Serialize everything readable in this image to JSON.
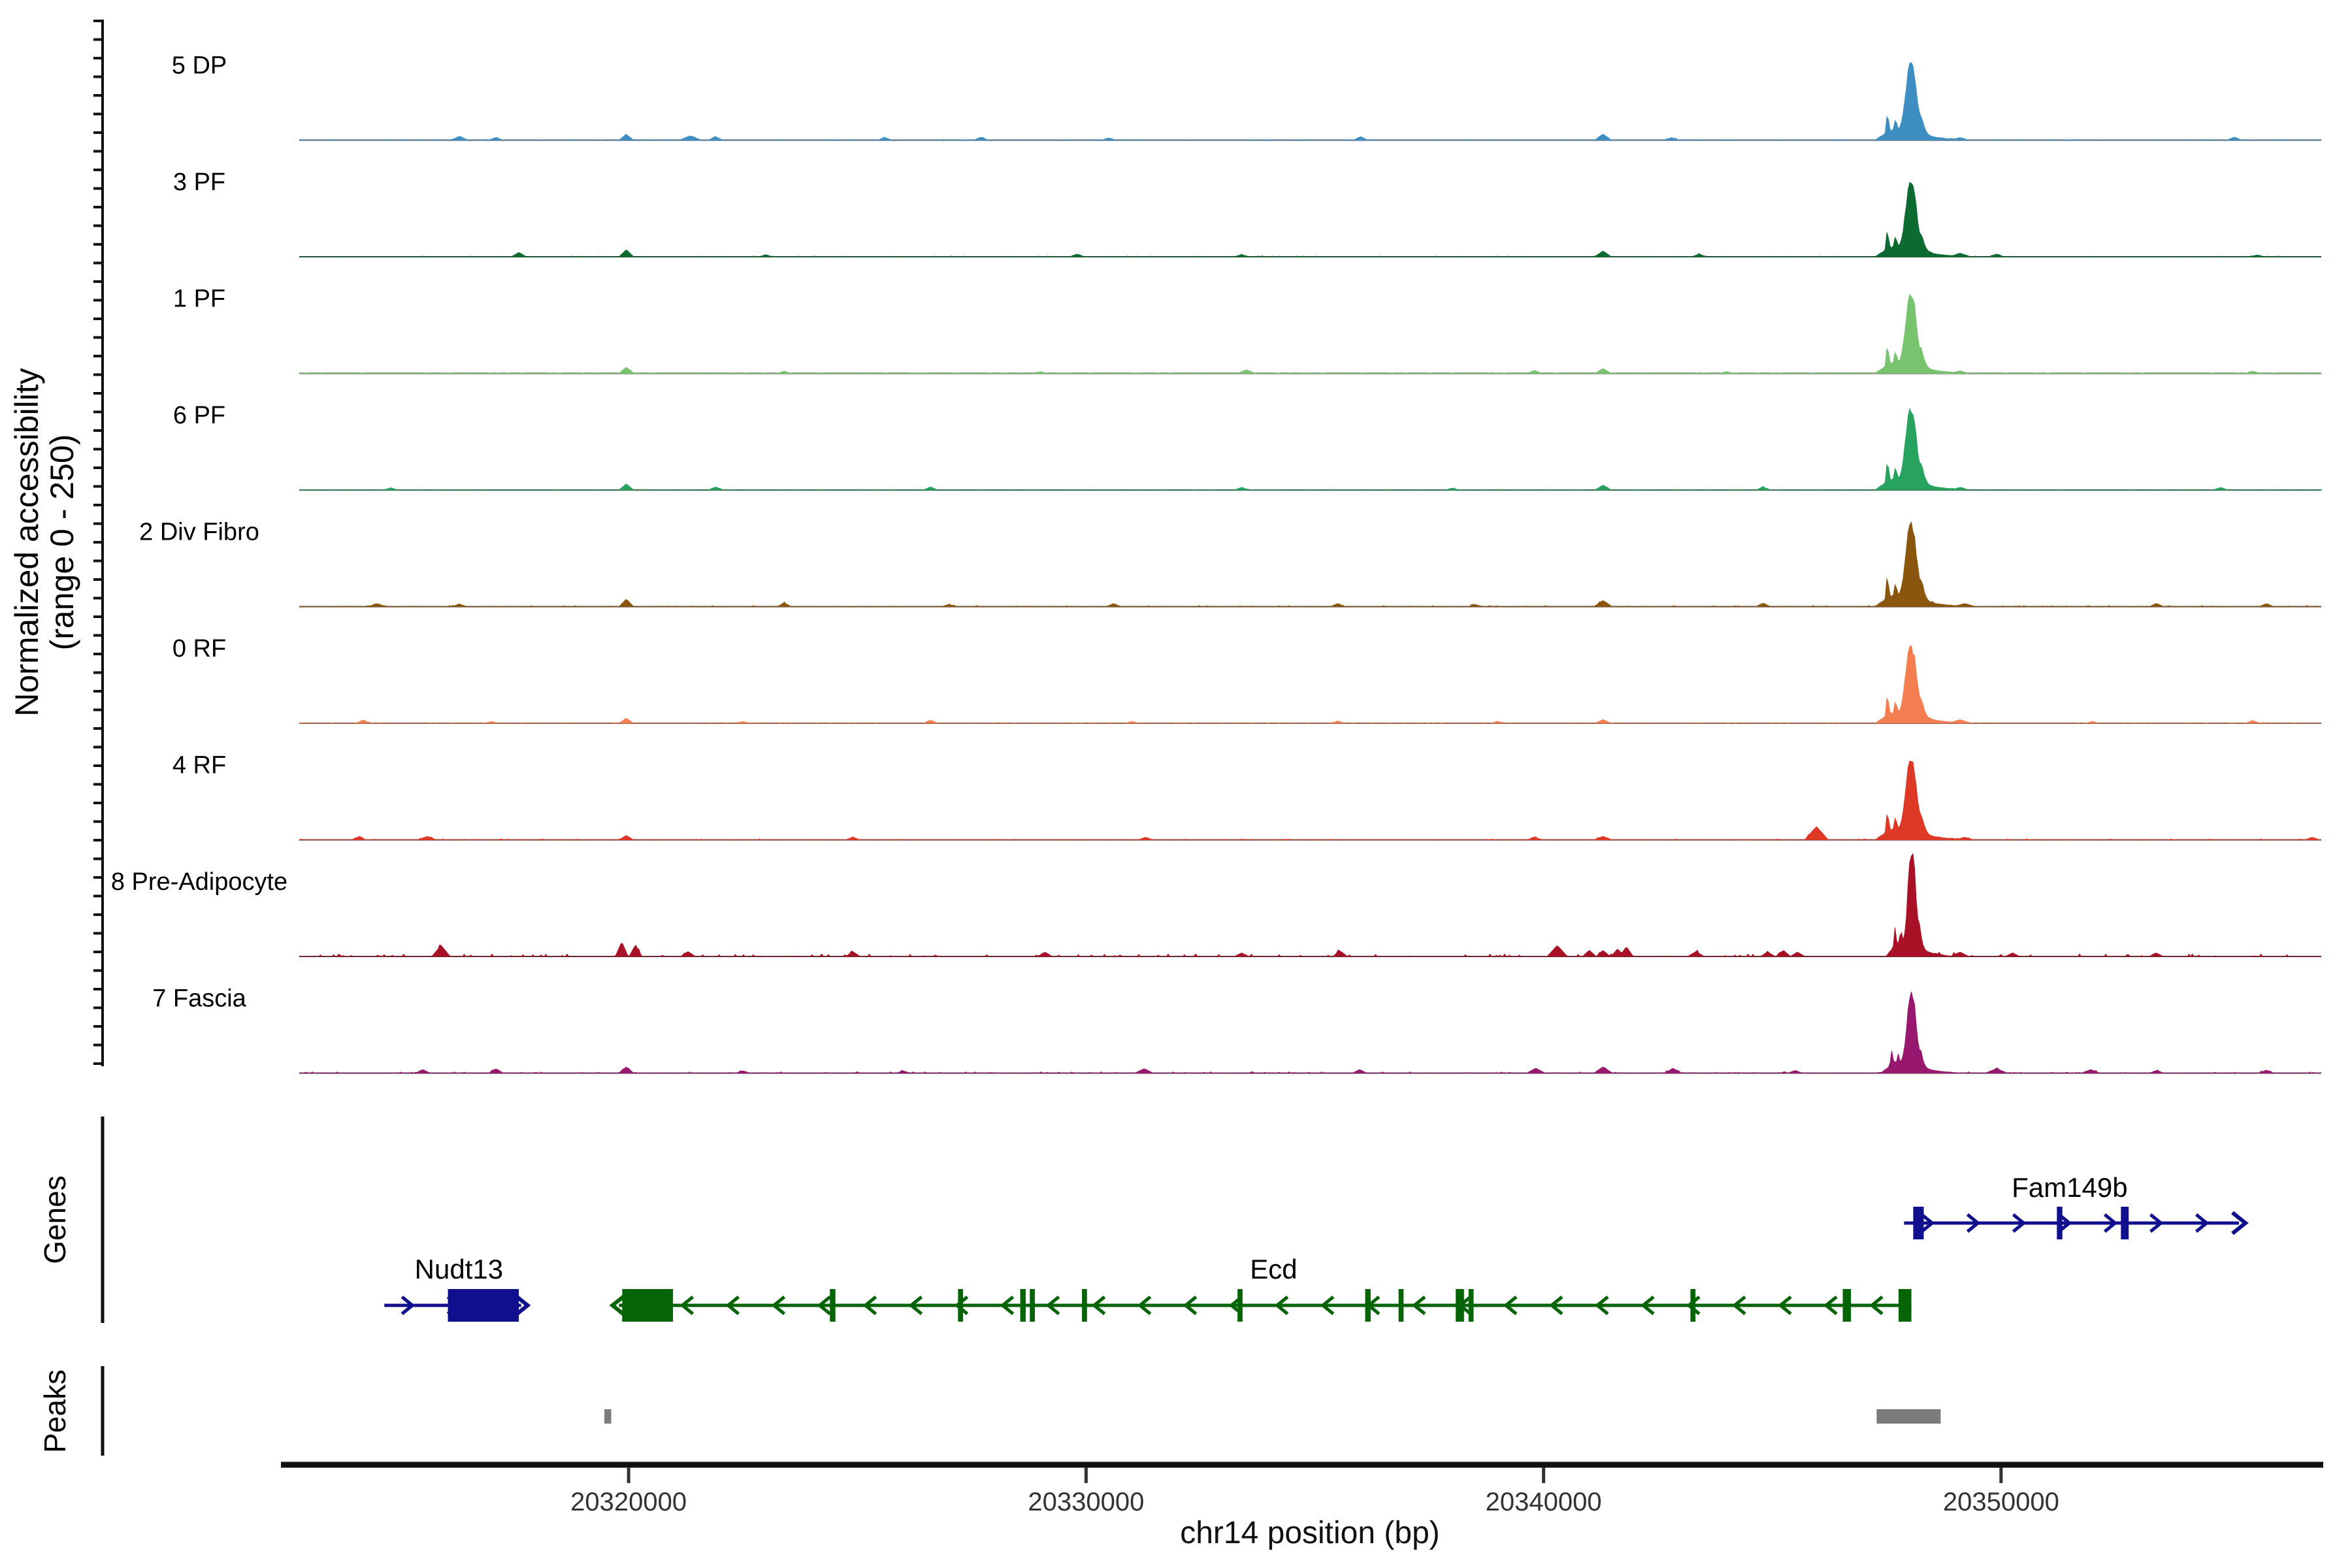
{
  "sections": {
    "genes": "Genes",
    "peaks": "Peaks"
  },
  "chart_data": {
    "type": "area",
    "title": "",
    "x_axis": {
      "label": "chr14 position (bp)",
      "ticks": [
        20320000,
        20330000,
        20340000,
        20350000
      ],
      "range": [
        20312800,
        20357000
      ]
    },
    "y_axis": {
      "title_line1": "Normalized accessibility",
      "title_line2": "(range 0 - 250)",
      "range": [
        0,
        250
      ]
    },
    "peak_profile": [
      [
        -850,
        0
      ],
      [
        -760,
        0.04
      ],
      [
        -640,
        0.08
      ],
      [
        -610,
        0.15
      ],
      [
        -595,
        0.34
      ],
      [
        -580,
        0.26
      ],
      [
        -565,
        0.3
      ],
      [
        -550,
        0.18
      ],
      [
        -520,
        0.13
      ],
      [
        -480,
        0.12
      ],
      [
        -440,
        0.16
      ],
      [
        -415,
        0.28
      ],
      [
        -400,
        0.22
      ],
      [
        -390,
        0.26
      ],
      [
        -370,
        0.16
      ],
      [
        -340,
        0.15
      ],
      [
        -300,
        0.18
      ],
      [
        -260,
        0.28
      ],
      [
        -230,
        0.4
      ],
      [
        -200,
        0.55
      ],
      [
        -170,
        0.72
      ],
      [
        -140,
        0.85
      ],
      [
        -115,
        0.93
      ],
      [
        -90,
        0.98
      ],
      [
        -65,
        1.0
      ],
      [
        -40,
        0.96
      ],
      [
        -15,
        0.92
      ],
      [
        10,
        0.84
      ],
      [
        35,
        0.72
      ],
      [
        60,
        0.58
      ],
      [
        85,
        0.45
      ],
      [
        110,
        0.36
      ],
      [
        135,
        0.3
      ],
      [
        160,
        0.32
      ],
      [
        185,
        0.26
      ],
      [
        215,
        0.19
      ],
      [
        250,
        0.13
      ],
      [
        290,
        0.09
      ],
      [
        340,
        0.06
      ],
      [
        420,
        0.045
      ],
      [
        500,
        0.035
      ],
      [
        600,
        0.028
      ],
      [
        720,
        0.02
      ],
      [
        850,
        0.014
      ],
      [
        1000,
        0.008
      ],
      [
        1200,
        0
      ]
    ],
    "tracks": [
      {
        "label": "5 DP",
        "color": "#3E8EC4",
        "peak_height": 171,
        "peak_center_bp": 20348100,
        "peak_width_scale": 1,
        "noise_level": 0.5,
        "bumps": [
          [
            20316300,
            8,
            200
          ],
          [
            20317100,
            6,
            160
          ],
          [
            20319950,
            13,
            160
          ],
          [
            20321350,
            10,
            240
          ],
          [
            20321900,
            8,
            160
          ],
          [
            20325600,
            6,
            160
          ],
          [
            20327700,
            7,
            160
          ],
          [
            20330500,
            5,
            160
          ],
          [
            20336000,
            8,
            160
          ],
          [
            20341300,
            14,
            180
          ],
          [
            20342800,
            6,
            160
          ],
          [
            20349100,
            6,
            200
          ],
          [
            20355100,
            7,
            160
          ]
        ]
      },
      {
        "label": "3 PF",
        "color": "#0B6B31",
        "peak_height": 166,
        "peak_center_bp": 20348100,
        "peak_width_scale": 1,
        "noise_level": 0.5,
        "bumps": [
          [
            20317600,
            10,
            160
          ],
          [
            20319950,
            16,
            160
          ],
          [
            20323000,
            4,
            160
          ],
          [
            20329800,
            6,
            160
          ],
          [
            20333400,
            5,
            160
          ],
          [
            20341300,
            13,
            180
          ],
          [
            20343400,
            6,
            160
          ],
          [
            20349100,
            8,
            240
          ],
          [
            20349900,
            6,
            160
          ],
          [
            20355600,
            4,
            160
          ]
        ]
      },
      {
        "label": "1 PF",
        "color": "#77C36E",
        "peak_height": 177,
        "peak_center_bp": 20348100,
        "peak_width_scale": 1,
        "noise_level": 0.4,
        "bumps": [
          [
            20319950,
            14,
            160
          ],
          [
            20323400,
            5,
            160
          ],
          [
            20329000,
            4,
            160
          ],
          [
            20333500,
            8,
            200
          ],
          [
            20339800,
            7,
            160
          ],
          [
            20341300,
            11,
            180
          ],
          [
            20344000,
            4,
            160
          ],
          [
            20349100,
            6,
            200
          ],
          [
            20355500,
            5,
            160
          ]
        ]
      },
      {
        "label": "6 PF",
        "color": "#27A35F",
        "peak_height": 183,
        "peak_center_bp": 20348100,
        "peak_width_scale": 1,
        "noise_level": 0.5,
        "bumps": [
          [
            20314800,
            5,
            160
          ],
          [
            20319950,
            14,
            160
          ],
          [
            20321900,
            7,
            160
          ],
          [
            20326600,
            7,
            160
          ],
          [
            20333400,
            6,
            160
          ],
          [
            20338000,
            4,
            160
          ],
          [
            20341300,
            11,
            180
          ],
          [
            20344800,
            7,
            160
          ],
          [
            20349100,
            6,
            200
          ],
          [
            20354800,
            6,
            160
          ]
        ]
      },
      {
        "label": "2 Div Fibro",
        "color": "#8A560E",
        "peak_height": 185,
        "peak_center_bp": 20348100,
        "peak_width_scale": 1,
        "noise_level": 0.8,
        "bumps": [
          [
            20314500,
            7,
            200
          ],
          [
            20316300,
            6,
            160
          ],
          [
            20319950,
            17,
            160
          ],
          [
            20323400,
            8,
            160
          ],
          [
            20327000,
            5,
            160
          ],
          [
            20330600,
            7,
            160
          ],
          [
            20335500,
            7,
            160
          ],
          [
            20338500,
            5,
            160
          ],
          [
            20341300,
            14,
            200
          ],
          [
            20344800,
            8,
            160
          ],
          [
            20349200,
            7,
            240
          ],
          [
            20353400,
            7,
            160
          ],
          [
            20355800,
            7,
            160
          ]
        ]
      },
      {
        "label": "0 RF",
        "color": "#F57E51",
        "peak_height": 174,
        "peak_center_bp": 20348100,
        "peak_width_scale": 1,
        "noise_level": 0.5,
        "bumps": [
          [
            20314200,
            7,
            160
          ],
          [
            20317000,
            4,
            160
          ],
          [
            20319950,
            11,
            160
          ],
          [
            20322500,
            4,
            160
          ],
          [
            20326600,
            7,
            160
          ],
          [
            20331000,
            4,
            160
          ],
          [
            20335500,
            5,
            160
          ],
          [
            20339000,
            4,
            160
          ],
          [
            20341300,
            8,
            180
          ],
          [
            20349100,
            8,
            260
          ],
          [
            20352000,
            4,
            160
          ],
          [
            20355500,
            6,
            160
          ]
        ]
      },
      {
        "label": "4 RF",
        "color": "#DE3926",
        "peak_height": 180,
        "peak_center_bp": 20348100,
        "peak_width_scale": 1,
        "noise_level": 0.6,
        "bumps": [
          [
            20314100,
            7,
            160
          ],
          [
            20315600,
            8,
            200
          ],
          [
            20319950,
            10,
            160
          ],
          [
            20324900,
            6,
            160
          ],
          [
            20331300,
            6,
            160
          ],
          [
            20339800,
            6,
            160
          ],
          [
            20341300,
            8,
            200
          ],
          [
            20345965,
            30,
            260
          ],
          [
            20349200,
            6,
            200
          ],
          [
            20356800,
            6,
            160
          ]
        ]
      },
      {
        "label": "8 Pre-Adipocyte",
        "color": "#A81126",
        "peak_height": 238,
        "peak_center_bp": 20348100,
        "peak_width_scale": 0.72,
        "noise_level": 1.7,
        "bumps": [
          [
            20315900,
            25,
            200
          ],
          [
            20319850,
            33,
            140
          ],
          [
            20320150,
            26,
            140
          ],
          [
            20321300,
            11,
            160
          ],
          [
            20324900,
            11,
            160
          ],
          [
            20329100,
            10,
            160
          ],
          [
            20333400,
            8,
            160
          ],
          [
            20335550,
            13,
            160
          ],
          [
            20340300,
            25,
            220
          ],
          [
            20341000,
            14,
            150
          ],
          [
            20341300,
            14,
            150
          ],
          [
            20341620,
            17,
            150
          ],
          [
            20341810,
            22,
            150
          ],
          [
            20343330,
            11,
            180
          ],
          [
            20344900,
            10,
            160
          ],
          [
            20345240,
            14,
            160
          ],
          [
            20345550,
            10,
            160
          ],
          [
            20349100,
            10,
            200
          ],
          [
            20350250,
            8,
            160
          ],
          [
            20353390,
            8,
            160
          ]
        ]
      },
      {
        "label": "7 Fascia",
        "color": "#97186E",
        "peak_height": 177,
        "peak_center_bp": 20348100,
        "peak_width_scale": 0.85,
        "noise_level": 0.9,
        "bumps": [
          [
            20315500,
            8,
            160
          ],
          [
            20317100,
            10,
            160
          ],
          [
            20319950,
            14,
            160
          ],
          [
            20322500,
            5,
            160
          ],
          [
            20326000,
            5,
            160
          ],
          [
            20331270,
            10,
            200
          ],
          [
            20335980,
            8,
            160
          ],
          [
            20339830,
            11,
            200
          ],
          [
            20341300,
            14,
            200
          ],
          [
            20342830,
            11,
            180
          ],
          [
            20345500,
            6,
            160
          ],
          [
            20349900,
            10,
            240
          ],
          [
            20351960,
            8,
            200
          ],
          [
            20353400,
            6,
            160
          ],
          [
            20355800,
            7,
            160
          ]
        ]
      }
    ],
    "genes": [
      {
        "name": "Fam149b",
        "color": "#10108E",
        "strand": "+",
        "row": 1,
        "start": 20347880,
        "end": 20355200,
        "label_bp": 20351500,
        "exons": [
          [
            20348080,
            20348310
          ],
          [
            20351220,
            20351340
          ],
          [
            20352620,
            20352790
          ]
        ]
      },
      {
        "name": "Nudt13",
        "color": "#10108E",
        "strand": "+",
        "row": 2,
        "start": 20314660,
        "end": 20317650,
        "label_bp": 20316290,
        "exons": [
          [
            20316050,
            20317600
          ]
        ]
      },
      {
        "name": "Ecd",
        "color": "#056405",
        "strand": "-",
        "row": 2,
        "start": 20319790,
        "end": 20348040,
        "label_bp": 20334100,
        "exons": [
          [
            20319860,
            20320970
          ],
          [
            20324400,
            20324520
          ],
          [
            20327200,
            20327310
          ],
          [
            20328560,
            20328680
          ],
          [
            20328770,
            20328880
          ],
          [
            20329910,
            20330020
          ],
          [
            20333310,
            20333420
          ],
          [
            20336100,
            20336220
          ],
          [
            20336830,
            20336940
          ],
          [
            20338080,
            20338260
          ],
          [
            20338360,
            20338470
          ],
          [
            20343210,
            20343320
          ],
          [
            20346540,
            20346720
          ],
          [
            20347760,
            20348040
          ]
        ]
      }
    ],
    "peak_regions": [
      [
        20319470,
        20319620
      ],
      [
        20347280,
        20348680
      ]
    ],
    "peak_region_color": "#7B7B7B"
  }
}
